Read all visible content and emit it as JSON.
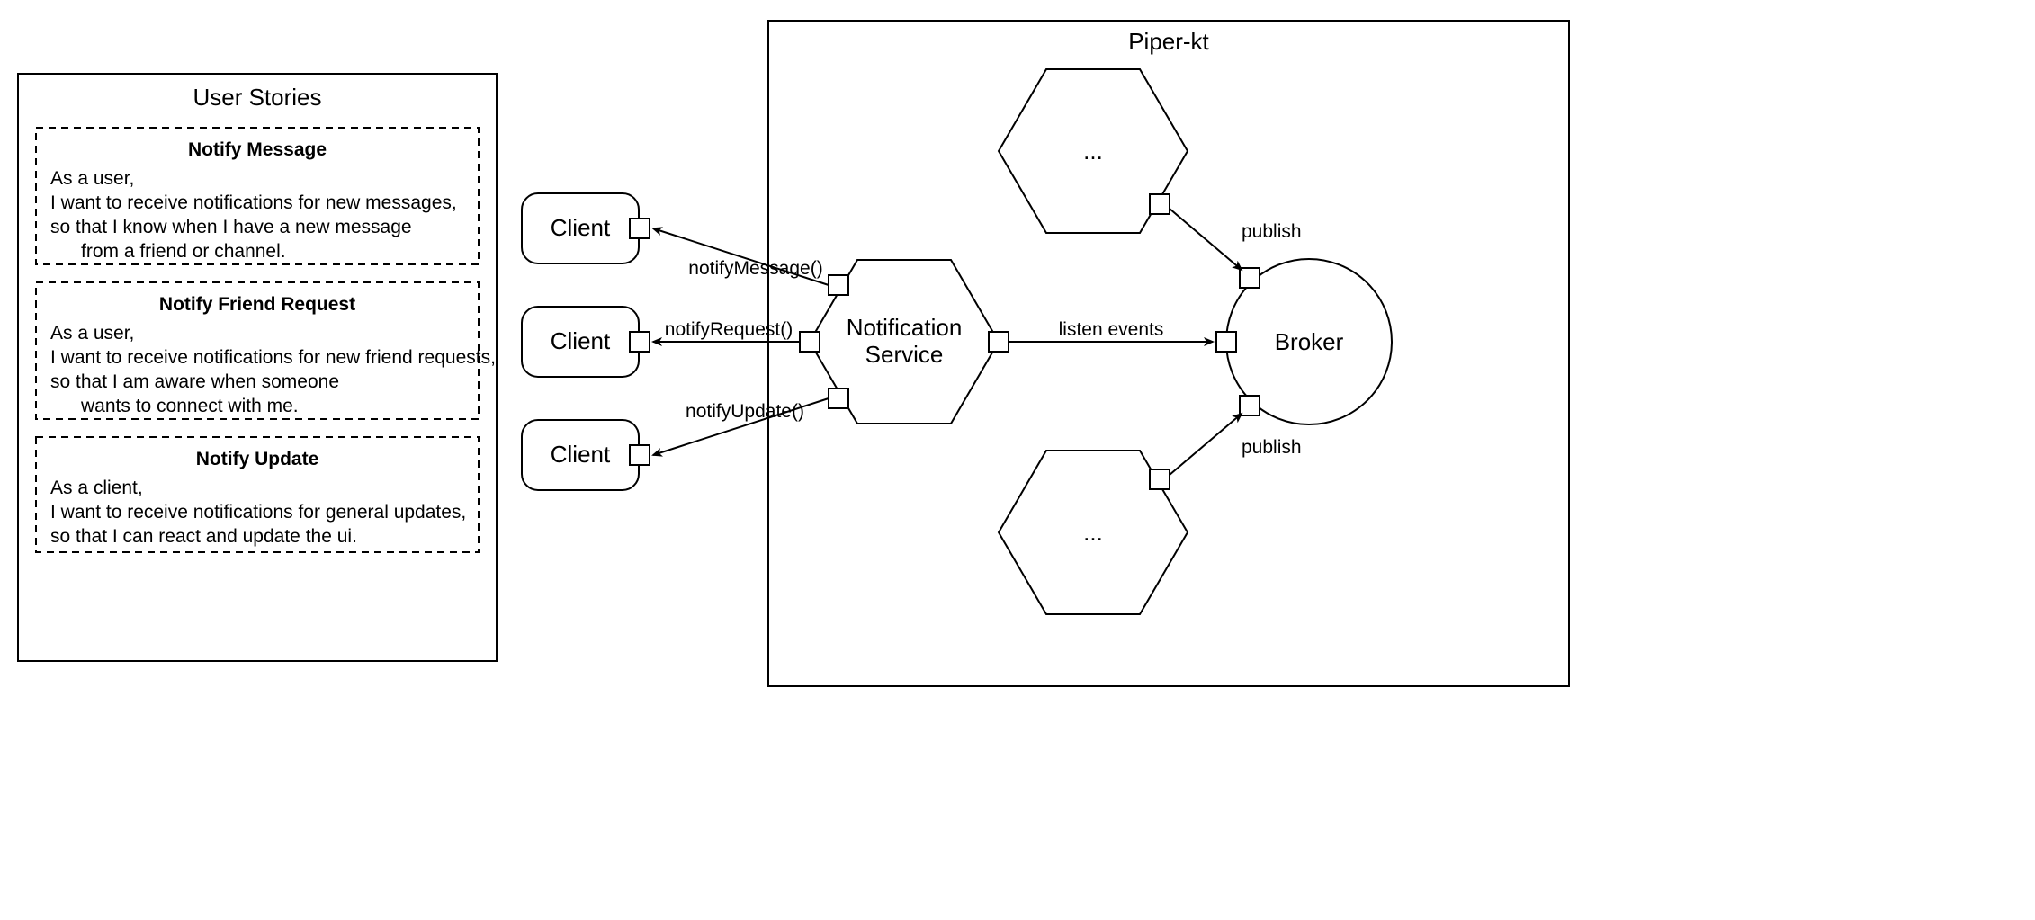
{
  "user_stories": {
    "title": "User Stories",
    "stories": [
      {
        "title": "Notify Message",
        "line1": "As a user,",
        "line2": "I want to receive notifications for new messages,",
        "line3": "so that I know when I have a new message",
        "line4": "from a friend or channel."
      },
      {
        "title": "Notify Friend Request",
        "line1": "As a user,",
        "line2": "I want to receive notifications for new friend requests,",
        "line3": "so that I am aware when someone",
        "line4": "wants to connect with me."
      },
      {
        "title": "Notify Update",
        "line1": "As a client,",
        "line2": "I want to receive notifications for general updates,",
        "line3": "so that I can react and update the ui.",
        "line4": ""
      }
    ]
  },
  "system": {
    "name": "Piper-kt",
    "clients": [
      "Client",
      "Client",
      "Client"
    ],
    "service": {
      "line1": "Notification",
      "line2": "Service"
    },
    "broker": "Broker",
    "hex_other": "...",
    "calls": {
      "notifyMessage": "notifyMessage()",
      "notifyRequest": "notifyRequest()",
      "notifyUpdate": "notifyUpdate()",
      "listen": "listen events",
      "publish": "publish"
    }
  }
}
